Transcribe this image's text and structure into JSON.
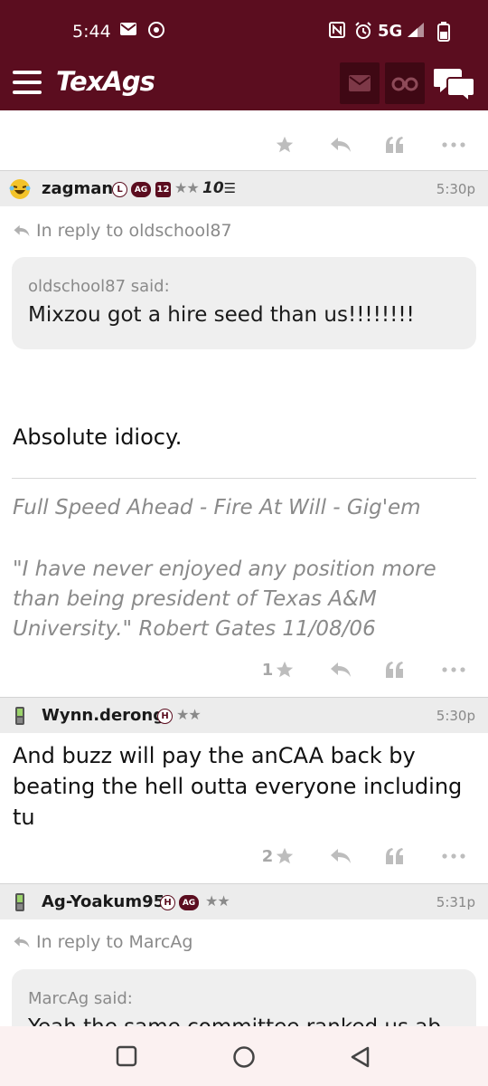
{
  "status_bar": {
    "time": "5:44",
    "network": "5G",
    "icons": [
      "mail-icon",
      "chrome-icon",
      "nfc-icon",
      "alarm-icon",
      "signal-icon",
      "battery-icon"
    ]
  },
  "app_bar": {
    "logo": "TexAgs",
    "icons": [
      "menu-icon",
      "envelope-icon",
      "binoculars-icon",
      "chat-bubbles-icon"
    ]
  },
  "colors": {
    "brand": "#5b0d1f",
    "brand_dark": "#3f0814",
    "muted": "#8a8a8a"
  },
  "posts": [
    {
      "username": "zagman",
      "badges": [
        "L",
        "AG",
        "12"
      ],
      "stars": "★★",
      "tenure": "10",
      "time": "5:30p",
      "reply_to": "In reply to oldschool87",
      "quote_author": "oldschool87 said:",
      "quote_text": "Mixzou got a hire seed than us!!!!!!!!",
      "body": "Absolute idiocy.",
      "signature_1": "Full Speed Ahead - Fire At Will - Gig'em",
      "signature_2": "\"I have never enjoyed any position more than being president of Texas A&M University.\" Robert Gates 11/08/06",
      "star_count": "1"
    },
    {
      "username": "Wynn.derong",
      "badges": [
        "H"
      ],
      "stars": "★★",
      "time": "5:30p",
      "body": "And buzz will pay the anCAA back by beating the hell outta everyone including tu",
      "star_count": "2"
    },
    {
      "username": "Ag-Yoakum95",
      "badges": [
        "H",
        "AG"
      ],
      "stars": "★★",
      "time": "5:31p",
      "reply_to": "In reply to MarcAg",
      "quote_author": "MarcAg said:",
      "quote_text": "Yeah the same committee ranked us ab"
    }
  ],
  "action_icons": [
    "star-icon",
    "reply-icon",
    "quote-icon",
    "more-icon"
  ],
  "nav_bar": {
    "icons": [
      "recents-icon",
      "home-icon",
      "back-icon"
    ]
  }
}
